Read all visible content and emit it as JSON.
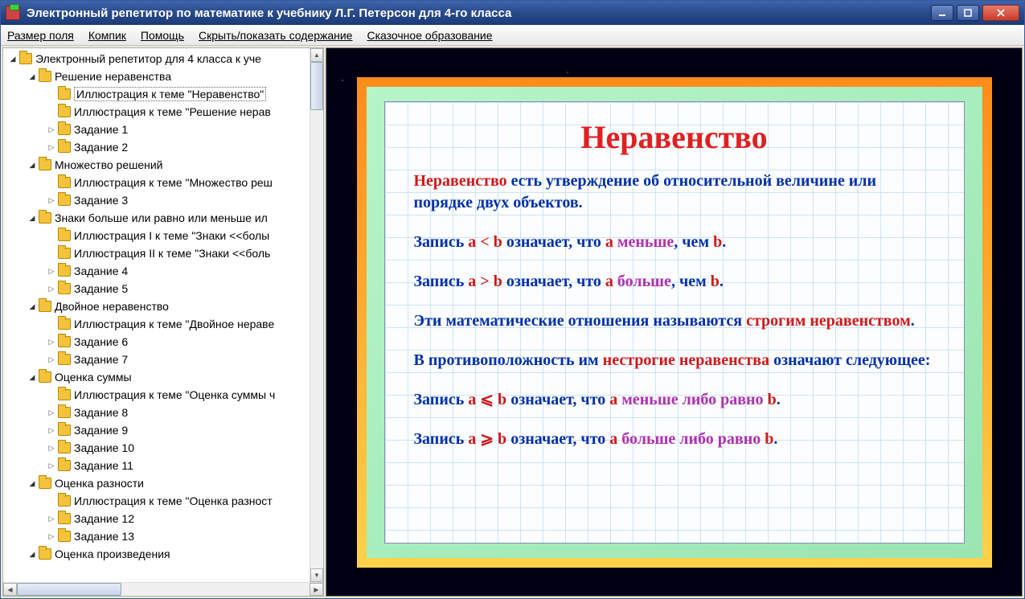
{
  "window": {
    "title": "Электронный репетитор по математике к учебнику Л.Г. Петерсон для 4-го класса"
  },
  "menu": {
    "size": "Размер поля",
    "kompik": "Компик",
    "help": "Помощь",
    "toggle_toc": "Скрыть/показать содержание",
    "edu": "Сказочное образование"
  },
  "tree": [
    {
      "depth": 0,
      "exp": "open",
      "label": "Электронный репетитор для 4 класса к уче"
    },
    {
      "depth": 1,
      "exp": "open",
      "label": "Решение неравенства"
    },
    {
      "depth": 2,
      "exp": "none",
      "label": "Иллюстрация к теме \"Неравенство\"",
      "selected": true
    },
    {
      "depth": 2,
      "exp": "none",
      "label": "Иллюстрация к теме \"Решение нерав"
    },
    {
      "depth": 2,
      "exp": "closed",
      "label": "Задание 1"
    },
    {
      "depth": 2,
      "exp": "closed",
      "label": "Задание 2"
    },
    {
      "depth": 1,
      "exp": "open",
      "label": "Множество решений"
    },
    {
      "depth": 2,
      "exp": "none",
      "label": "Иллюстрация к теме \"Множество реш"
    },
    {
      "depth": 2,
      "exp": "closed",
      "label": "Задание 3"
    },
    {
      "depth": 1,
      "exp": "open",
      "label": "Знаки больше или равно или меньше ил"
    },
    {
      "depth": 2,
      "exp": "none",
      "label": "Иллюстрация I к теме \"Знаки <<болы"
    },
    {
      "depth": 2,
      "exp": "none",
      "label": "Иллюстрация II к теме \"Знаки <<боль"
    },
    {
      "depth": 2,
      "exp": "closed",
      "label": "Задание 4"
    },
    {
      "depth": 2,
      "exp": "closed",
      "label": "Задание 5"
    },
    {
      "depth": 1,
      "exp": "open",
      "label": "Двойное неравенство"
    },
    {
      "depth": 2,
      "exp": "none",
      "label": "Иллюстрация к теме \"Двойное нераве"
    },
    {
      "depth": 2,
      "exp": "closed",
      "label": "Задание 6"
    },
    {
      "depth": 2,
      "exp": "closed",
      "label": "Задание 7"
    },
    {
      "depth": 1,
      "exp": "open",
      "label": "Оценка суммы"
    },
    {
      "depth": 2,
      "exp": "none",
      "label": "Иллюстрация к теме \"Оценка суммы ч"
    },
    {
      "depth": 2,
      "exp": "closed",
      "label": "Задание 8"
    },
    {
      "depth": 2,
      "exp": "closed",
      "label": "Задание 9"
    },
    {
      "depth": 2,
      "exp": "closed",
      "label": "Задание 10"
    },
    {
      "depth": 2,
      "exp": "closed",
      "label": "Задание 11"
    },
    {
      "depth": 1,
      "exp": "open",
      "label": "Оценка разности"
    },
    {
      "depth": 2,
      "exp": "none",
      "label": "Иллюстрация к теме \"Оценка разност"
    },
    {
      "depth": 2,
      "exp": "closed",
      "label": "Задание 12"
    },
    {
      "depth": 2,
      "exp": "closed",
      "label": "Задание 13"
    },
    {
      "depth": 1,
      "exp": "open",
      "label": "Оценка произведения"
    }
  ],
  "content": {
    "title": "Неравенство",
    "p1a": "Неравенство",
    "p1b": " есть утверждение об относительной ве­личине или порядке двух объектов.",
    "p2a": "Запись ",
    "p2b": "a < b",
    "p2c": " означает, что ",
    "p2d": "a",
    "p2e": " меньше",
    "p2f": ", чем ",
    "p2g": "b",
    "p2h": ".",
    "p3a": "Запись ",
    "p3b": "a > b",
    "p3c": " означает, что ",
    "p3d": "a",
    "p3e": " больше",
    "p3f": ", чем ",
    "p3g": "b",
    "p3h": ".",
    "p4a": "Эти математические отношения называются ",
    "p4b": "строгим неравенством",
    "p4c": ".",
    "p5a": "В противоположность им ",
    "p5b": "нестрогие неравенства",
    "p5c": " оз­начают следующее:",
    "p6a": "Запись ",
    "p6b": "a ⩽ b",
    "p6c": " означает, что ",
    "p6d": "a",
    "p6e": " меньше либо равно ",
    "p6f": "b",
    "p6g": ".",
    "p7a": "Запись ",
    "p7b": "a ⩾ b",
    "p7c": " означает, что ",
    "p7d": "a",
    "p7e": " больше либо равно ",
    "p7f": "b",
    "p7g": "."
  }
}
